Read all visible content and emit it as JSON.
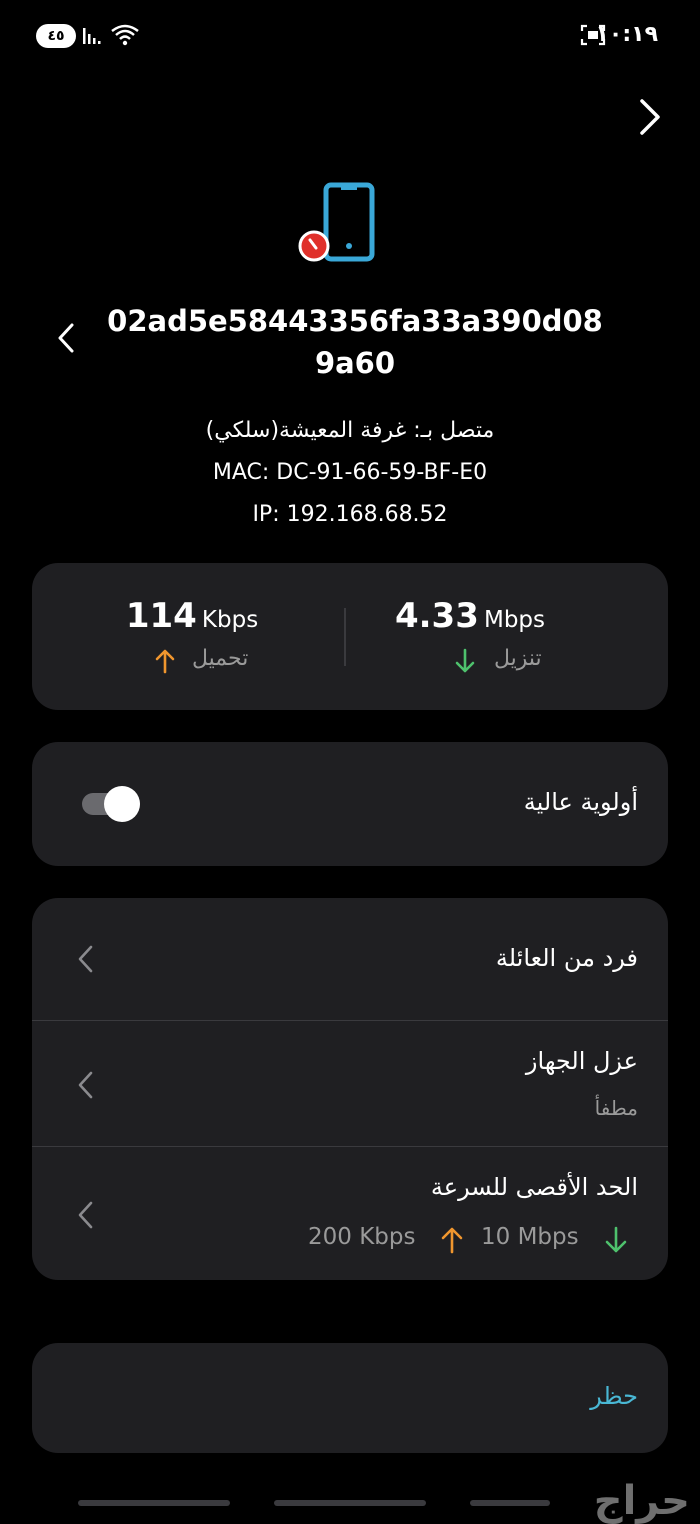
{
  "status_bar": {
    "time": "١٠:١٩",
    "battery": "٤٥"
  },
  "device": {
    "name": "02ad5e58443356fa33a390d089a60",
    "connected_via": "متصل بـ: غرفة المعيشة(سلكي)",
    "mac": "MAC: DC-91-66-59-BF-E0",
    "ip": "IP: 192.168.68.52"
  },
  "speeds": {
    "upload_value": "114",
    "upload_unit": "Kbps",
    "upload_label": "تحميل",
    "download_value": "4.33",
    "download_unit": "Mbps",
    "download_label": "تنزيل"
  },
  "priority": {
    "label": "أولوية عالية",
    "enabled": true
  },
  "settings": {
    "family_member": "فرد من العائلة",
    "isolate_title": "عزل الجهاز",
    "isolate_status": "مطفأ",
    "speed_limit_title": "الحد الأقصى للسرعة",
    "limit_upload": "200 Kbps",
    "limit_download": "10 Mbps"
  },
  "block": {
    "label": "حظر"
  },
  "watermark": "حراج",
  "colors": {
    "upload_arrow": "#f0962e",
    "download_arrow": "#4ec16d",
    "accent": "#49b7d4",
    "device_icon": "#3aa8d8",
    "badge": "#e0302a"
  }
}
